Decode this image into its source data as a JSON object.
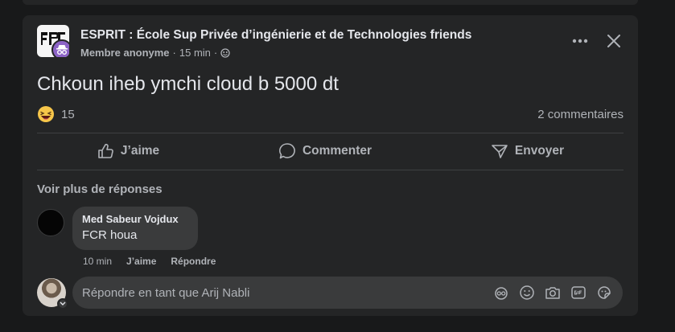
{
  "post": {
    "group_name": "ESPRIT : École Sup Privée d’ingénierie et de Technologies friends",
    "author": "Membre anonyme",
    "separator": "·",
    "time": "15 min",
    "separator2": "·",
    "text": "Chkoun iheb ymchi cloud b 5000 dt",
    "reaction_count": "15",
    "comments_count": "2 commentaires"
  },
  "actions": {
    "like": "J’aime",
    "comment": "Commenter",
    "send": "Envoyer"
  },
  "comments": {
    "more_replies": "Voir plus de réponses",
    "items": [
      {
        "author": "Med Sabeur Vojdux",
        "text": "FCR houa",
        "time": "10 min",
        "like": "J’aime",
        "reply": "Répondre"
      }
    ]
  },
  "reply": {
    "placeholder": "Répondre en tant que Arij Nabli"
  },
  "icons": {
    "more": "more-horizontal-icon",
    "close": "close-icon",
    "audience": "globe-icon",
    "reaction": "laughing-emoji-icon"
  },
  "colors": {
    "background": "#18191a",
    "card": "#242526",
    "bubble": "#3a3b3c",
    "text_primary": "#e4e6eb",
    "text_secondary": "#b0b3b8",
    "anon_badge": "#8c63c6"
  }
}
